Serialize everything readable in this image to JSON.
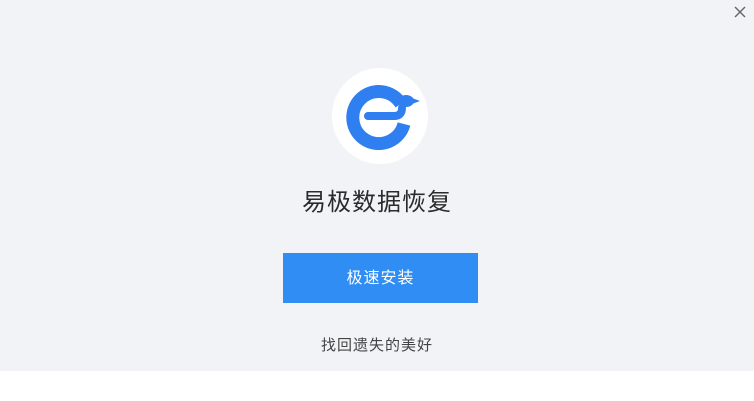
{
  "window": {
    "close_icon": "close-icon",
    "logo_icon": "easy-recovery-logo-icon"
  },
  "app": {
    "title": "易极数据恢复",
    "install_label": "极速安装",
    "tagline": "找回遗失的美好"
  },
  "colors": {
    "background": "#f2f3f6",
    "accent": "#2f8df3",
    "logo_blue": "#2f7ff0"
  }
}
